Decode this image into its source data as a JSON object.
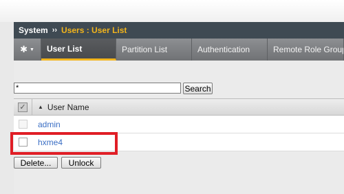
{
  "breadcrumb": {
    "section": "System",
    "separator": "››",
    "page": "Users : User List"
  },
  "tabs": [
    {
      "label": "User List",
      "active": true
    },
    {
      "label": "Partition List",
      "active": false
    },
    {
      "label": "Authentication",
      "active": false
    },
    {
      "label": "Remote Role Group",
      "active": false
    }
  ],
  "gear_menu": {
    "icon": "gear-icon",
    "caret": "▼"
  },
  "search": {
    "value": "*",
    "button_label": "Search"
  },
  "table": {
    "header_checkbox": "✓",
    "sort_indicator": "▲",
    "column_header": "User Name",
    "rows": [
      {
        "username": "admin",
        "checkbox_enabled": false
      },
      {
        "username": "hxme4",
        "checkbox_enabled": true
      }
    ]
  },
  "actions": {
    "delete_label": "Delete...",
    "unlock_label": "Unlock"
  },
  "colors": {
    "breadcrumb_bg": "#3f4a53",
    "accent": "#f2b41c",
    "link": "#3a6ec4",
    "highlight": "#e01e26"
  }
}
